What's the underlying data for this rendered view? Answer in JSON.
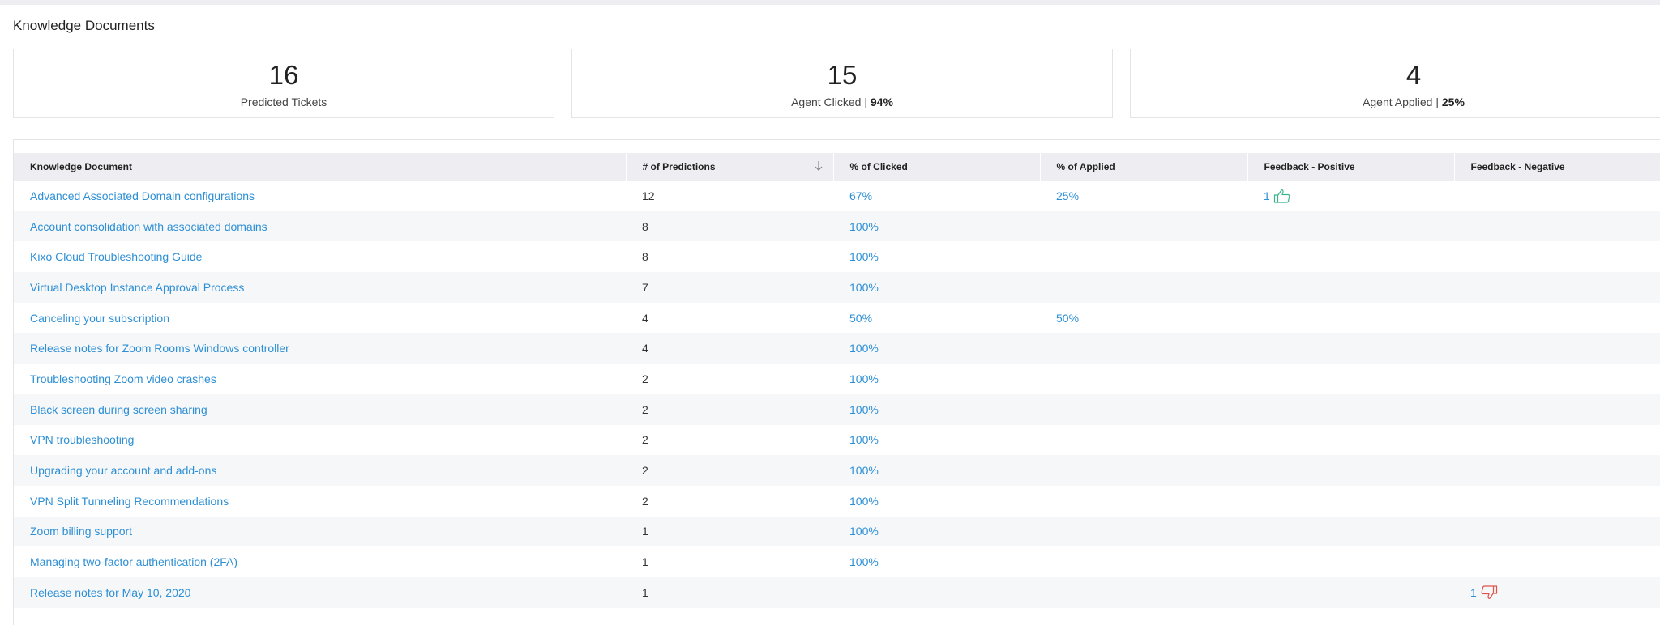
{
  "section_title": "Knowledge Documents",
  "stats": [
    {
      "value": "16",
      "label": "Predicted Tickets",
      "pct": ""
    },
    {
      "value": "15",
      "label": "Agent Clicked | ",
      "pct": "94%"
    },
    {
      "value": "4",
      "label": "Agent Applied | ",
      "pct": "25%"
    }
  ],
  "table": {
    "columns": [
      "Knowledge Document",
      "# of Predictions",
      "% of Clicked",
      "% of Applied",
      "Feedback - Positive",
      "Feedback - Negative"
    ],
    "rows": [
      {
        "doc": "Advanced Associated Domain configurations",
        "predictions": "12",
        "clicked": "67%",
        "applied": "25%",
        "pos": "1",
        "neg": ""
      },
      {
        "doc": "Account consolidation with associated domains",
        "predictions": "8",
        "clicked": "100%",
        "applied": "",
        "pos": "",
        "neg": ""
      },
      {
        "doc": "Kixo Cloud Troubleshooting Guide",
        "predictions": "8",
        "clicked": "100%",
        "applied": "",
        "pos": "",
        "neg": ""
      },
      {
        "doc": "Virtual Desktop Instance Approval Process",
        "predictions": "7",
        "clicked": "100%",
        "applied": "",
        "pos": "",
        "neg": ""
      },
      {
        "doc": "Canceling your subscription",
        "predictions": "4",
        "clicked": "50%",
        "applied": "50%",
        "pos": "",
        "neg": ""
      },
      {
        "doc": "Release notes for Zoom Rooms Windows controller",
        "predictions": "4",
        "clicked": "100%",
        "applied": "",
        "pos": "",
        "neg": ""
      },
      {
        "doc": "Troubleshooting Zoom video crashes",
        "predictions": "2",
        "clicked": "100%",
        "applied": "",
        "pos": "",
        "neg": ""
      },
      {
        "doc": "Black screen during screen sharing",
        "predictions": "2",
        "clicked": "100%",
        "applied": "",
        "pos": "",
        "neg": ""
      },
      {
        "doc": "VPN troubleshooting",
        "predictions": "2",
        "clicked": "100%",
        "applied": "",
        "pos": "",
        "neg": ""
      },
      {
        "doc": "Upgrading your account and add-ons",
        "predictions": "2",
        "clicked": "100%",
        "applied": "",
        "pos": "",
        "neg": ""
      },
      {
        "doc": "VPN Split Tunneling Recommendations",
        "predictions": "2",
        "clicked": "100%",
        "applied": "",
        "pos": "",
        "neg": ""
      },
      {
        "doc": "Zoom billing support",
        "predictions": "1",
        "clicked": "100%",
        "applied": "",
        "pos": "",
        "neg": ""
      },
      {
        "doc": "Managing two-factor authentication (2FA)",
        "predictions": "1",
        "clicked": "100%",
        "applied": "",
        "pos": "",
        "neg": ""
      },
      {
        "doc": "Release notes for May 10, 2020",
        "predictions": "1",
        "clicked": "",
        "applied": "",
        "pos": "",
        "neg": "1"
      }
    ]
  },
  "icons": {
    "sort": "arrow-down-icon",
    "positive": "thumbs-up-icon",
    "negative": "thumbs-down-icon"
  },
  "colors": {
    "link": "#2d8fd5",
    "thumbs_up": "#3cb48c",
    "thumbs_down": "#e0524a",
    "header_bg": "#ededf2",
    "stripe_bg": "#f6f7f9"
  }
}
